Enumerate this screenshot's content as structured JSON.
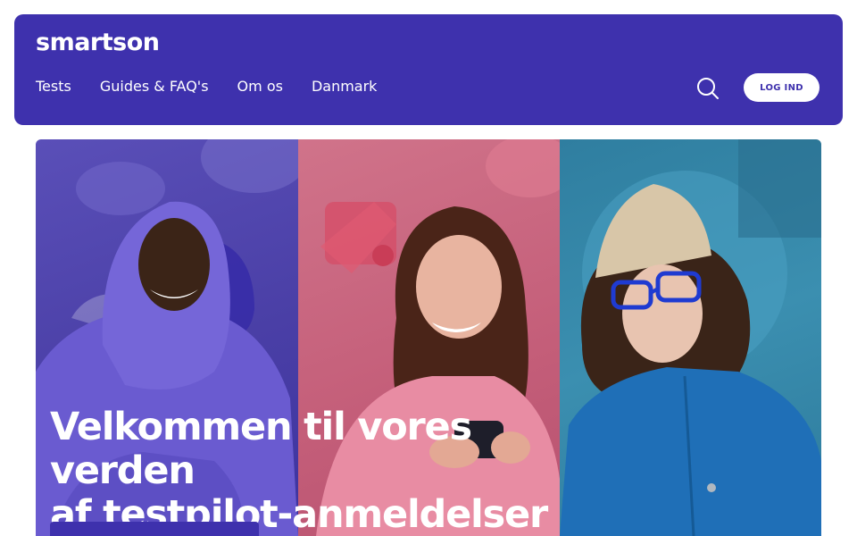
{
  "header": {
    "logo": "smartson",
    "nav": [
      "Tests",
      "Guides & FAQ's",
      "Om os",
      "Danmark"
    ],
    "search_icon": "search-icon",
    "login_label": "LOG IND"
  },
  "hero": {
    "title_line1": "Velkommen til vores verden",
    "title_line2": "af testpilot-anmeldelser",
    "panels": [
      {
        "name": "hooded-man-photo",
        "tint": "#4a3fa6"
      },
      {
        "name": "woman-with-phone-photo",
        "tint": "#c45e79"
      },
      {
        "name": "woman-with-glasses-photo",
        "tint": "#3b8fb0"
      }
    ]
  },
  "colors": {
    "brand": "#3e31ad",
    "white": "#ffffff"
  }
}
